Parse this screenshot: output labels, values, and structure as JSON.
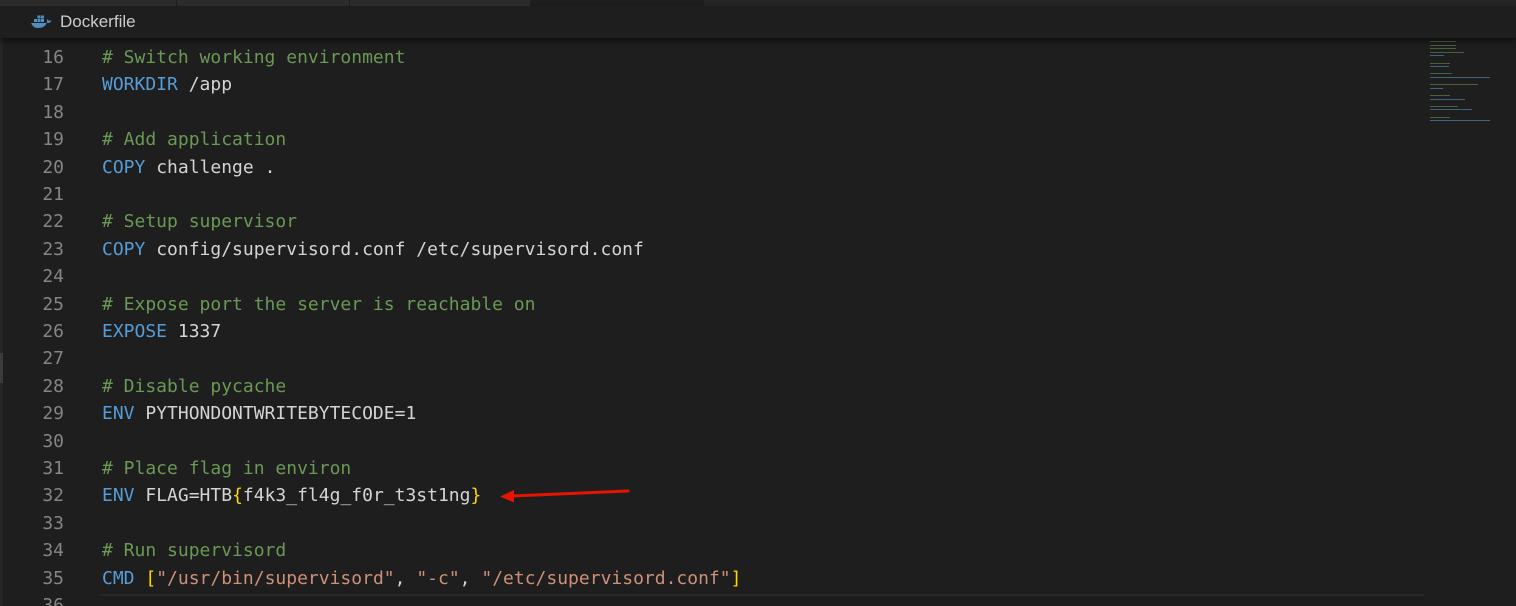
{
  "tab_file": "Dockerfile",
  "icons": {
    "file_type": "docker-whale-icon"
  },
  "colors": {
    "background": "#1e1e1e",
    "comment": "#6a9955",
    "keyword": "#569cd6",
    "string": "#ce9178",
    "text": "#d4d4d4",
    "line_number": "#858585",
    "bracket_outer": "#ffd700",
    "bracket_inner": "#da70d6",
    "annotation_arrow": "#e51400"
  },
  "lines": [
    {
      "num": "16",
      "parts": [
        {
          "t": "# Switch working environment",
          "c": "comment"
        }
      ]
    },
    {
      "num": "17",
      "parts": [
        {
          "t": "WORKDIR",
          "c": "kw"
        },
        {
          "t": " /app",
          "c": ""
        }
      ]
    },
    {
      "num": "18",
      "parts": []
    },
    {
      "num": "19",
      "parts": [
        {
          "t": "# Add application",
          "c": "comment"
        }
      ]
    },
    {
      "num": "20",
      "parts": [
        {
          "t": "COPY",
          "c": "kw"
        },
        {
          "t": " challenge .",
          "c": ""
        }
      ]
    },
    {
      "num": "21",
      "parts": []
    },
    {
      "num": "22",
      "parts": [
        {
          "t": "# Setup supervisor",
          "c": "comment"
        }
      ]
    },
    {
      "num": "23",
      "parts": [
        {
          "t": "COPY",
          "c": "kw"
        },
        {
          "t": " config/supervisord.conf /etc/supervisord.conf",
          "c": ""
        }
      ]
    },
    {
      "num": "24",
      "parts": []
    },
    {
      "num": "25",
      "parts": [
        {
          "t": "# Expose port the server is reachable on",
          "c": "comment"
        }
      ]
    },
    {
      "num": "26",
      "parts": [
        {
          "t": "EXPOSE",
          "c": "kw"
        },
        {
          "t": " 1337",
          "c": ""
        }
      ]
    },
    {
      "num": "27",
      "parts": []
    },
    {
      "num": "28",
      "parts": [
        {
          "t": "# Disable pycache",
          "c": "comment"
        }
      ]
    },
    {
      "num": "29",
      "parts": [
        {
          "t": "ENV",
          "c": "kw"
        },
        {
          "t": " PYTHONDONTWRITEBYTECODE=1",
          "c": ""
        }
      ]
    },
    {
      "num": "30",
      "parts": []
    },
    {
      "num": "31",
      "parts": [
        {
          "t": "# Place flag in environ",
          "c": "comment"
        }
      ]
    },
    {
      "num": "32",
      "parts": [
        {
          "t": "ENV",
          "c": "kw"
        },
        {
          "t": " FLAG=HTB",
          "c": ""
        },
        {
          "t": "{",
          "c": "brk-y"
        },
        {
          "t": "f4k3_fl4g_f0r_t3st1ng",
          "c": ""
        },
        {
          "t": "}",
          "c": "brk-y"
        }
      ]
    },
    {
      "num": "33",
      "parts": []
    },
    {
      "num": "34",
      "parts": [
        {
          "t": "# Run supervisord",
          "c": "comment"
        }
      ]
    },
    {
      "num": "35",
      "parts": [
        {
          "t": "CMD",
          "c": "kw"
        },
        {
          "t": " ",
          "c": ""
        },
        {
          "t": "[",
          "c": "brk-y"
        },
        {
          "t": "\"/usr/bin/supervisord\"",
          "c": "str"
        },
        {
          "t": ", ",
          "c": ""
        },
        {
          "t": "\"-c\"",
          "c": "str"
        },
        {
          "t": ", ",
          "c": ""
        },
        {
          "t": "\"/etc/supervisord.conf\"",
          "c": "str"
        },
        {
          "t": "]",
          "c": "brk-y"
        }
      ]
    },
    {
      "num": "36",
      "parts": []
    }
  ]
}
